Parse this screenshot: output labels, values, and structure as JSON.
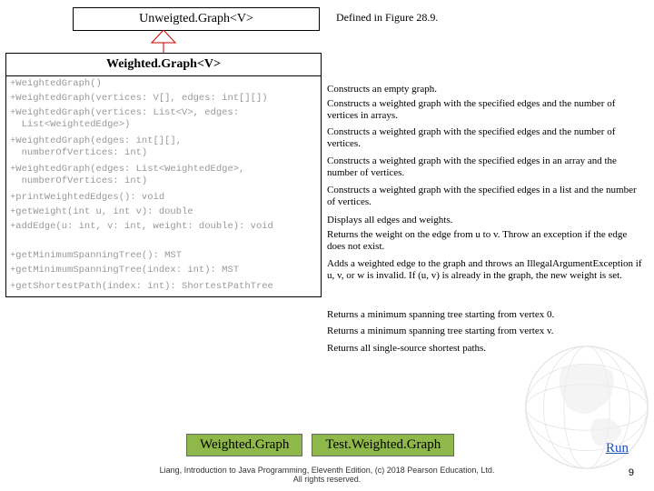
{
  "parent_class": "Unweigted.Graph<V>",
  "defined_note": "Defined in Figure 28.9.",
  "class_title": "Weighted.Graph<V>",
  "members": [
    "+WeightedGraph()",
    "+WeightedGraph(vertices: V[], edges: int[][])",
    "+WeightedGraph(vertices: List<V>, edges:\n  List<WeightedEdge>)",
    "+WeightedGraph(edges: int[][],\n  numberOfVertices: int)",
    "+WeightedGraph(edges: List<WeightedEdge>,\n  numberOfVertices: int)",
    "+printWeightedEdges(): void",
    "+getWeight(int u, int v): double",
    "+addEdge(u: int, v: int, weight: double): void",
    "+getMinimumSpanningTree(): MST",
    "+getMinimumSpanningTree(index: int): MST",
    "+getShortestPath(index: int): ShortestPathTree"
  ],
  "descriptions": [
    "Constructs an empty graph.",
    "Constructs a weighted graph with the specified edges and the number of vertices in arrays.",
    "Constructs a weighted graph with the specified edges and the number of vertices.",
    "Constructs a weighted graph with the specified edges in an array and the number of vertices.",
    "Constructs a weighted graph with the specified edges in a list and the number of vertices.",
    "Displays all edges and weights.",
    "Returns the weight on the edge from u to v. Throw an exception if the edge does not exist.",
    "Adds a weighted edge to the graph and throws an IllegalArgumentException if u, v, or w is invalid. If (u, v) is already in the graph, the new weight is set.",
    "Returns a minimum spanning tree starting from vertex 0.",
    "Returns a minimum spanning tree starting from vertex v.",
    "Returns all single-source shortest paths."
  ],
  "desc_tops": [
    0,
    16,
    47,
    79,
    111,
    144,
    160,
    192,
    248,
    266,
    285
  ],
  "member_heights": [
    16,
    16,
    31,
    31,
    31,
    16,
    16,
    32,
    16,
    18,
    19
  ],
  "buttons": {
    "weighted": "Weighted.Graph",
    "test": "Test.Weighted.Graph",
    "run": "Run"
  },
  "footer_line1": "Liang, Introduction to Java Programming, Eleventh Edition, (c) 2018 Pearson Education, Ltd.",
  "footer_line2": "All rights reserved.",
  "slide_number": "9"
}
